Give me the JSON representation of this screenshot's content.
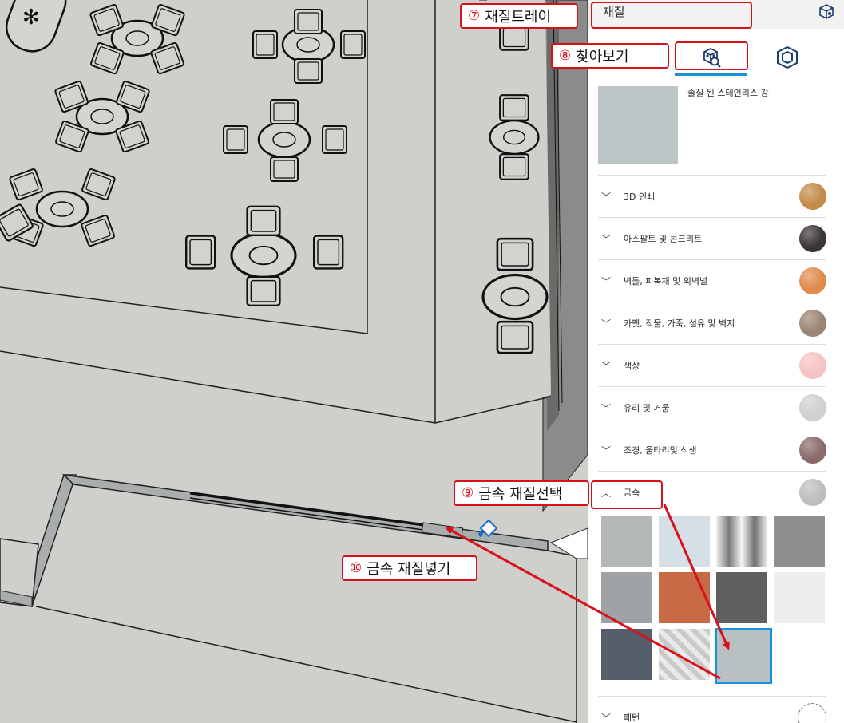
{
  "app": {
    "viewport": "sketchup-model-view",
    "accent": "#1a8fd8",
    "callout_color": "#d8101a"
  },
  "panel": {
    "title": "재질",
    "tabs": [
      {
        "name": "browse",
        "icon": "material-browse-icon",
        "active": true
      },
      {
        "name": "edit",
        "icon": "material-edit-icon",
        "active": false
      }
    ],
    "current_material": {
      "name": "솔질 된 스테인리스 강",
      "color": "#b9c0c2"
    },
    "categories": [
      {
        "label": "3D 인쇄",
        "expanded": false,
        "thumb_color": "#c48a49"
      },
      {
        "label": "아스팔트 및 콘크리트",
        "expanded": false,
        "thumb_color": "#3b3536"
      },
      {
        "label": "벽돌, 피복재 및 외벽널",
        "expanded": false,
        "thumb_color": "#e08a4c"
      },
      {
        "label": "카펫, 직물, 가죽, 섬유 및 벽지",
        "expanded": false,
        "thumb_color": "#9b8472"
      },
      {
        "label": "색상",
        "expanded": false,
        "thumb_color": "#f7c2c2"
      },
      {
        "label": "유리 및 거울",
        "expanded": false,
        "thumb_color": "#cfcfcf"
      },
      {
        "label": "조경, 울타리및 식생",
        "expanded": false,
        "thumb_color": "#8a6a6a"
      },
      {
        "label": "금속",
        "expanded": true,
        "thumb_color": "#bdbdbd"
      },
      {
        "label": "패턴",
        "expanded": false,
        "thumb_color": "#ffffff"
      }
    ],
    "metal_swatches": [
      {
        "color": "#b5b8b9",
        "selected": false
      },
      {
        "color": "#d7dfe6",
        "selected": false
      },
      {
        "color": "#9a9a9a",
        "selected": false
      },
      {
        "color": "#8f8f8f",
        "selected": false
      },
      {
        "color": "#9fa3a5",
        "selected": false
      },
      {
        "color": "#c86a45",
        "selected": false
      },
      {
        "color": "#5e605e",
        "selected": false
      },
      {
        "color": "#eeeef1",
        "selected": false
      },
      {
        "color": "#565d6b",
        "selected": false
      },
      {
        "color": "#d3d3d3",
        "selected": false
      },
      {
        "color": "#b9c0c2",
        "selected": true
      }
    ]
  },
  "callouts": {
    "tray": {
      "num": "⑦",
      "text": "재질트레이"
    },
    "browse": {
      "num": "⑧",
      "text": "찾아보기"
    },
    "select_metal": {
      "num": "⑨",
      "text": "금속 재질선택"
    },
    "apply_metal": {
      "num": "⑩",
      "text": "금속 재질넣기"
    }
  }
}
